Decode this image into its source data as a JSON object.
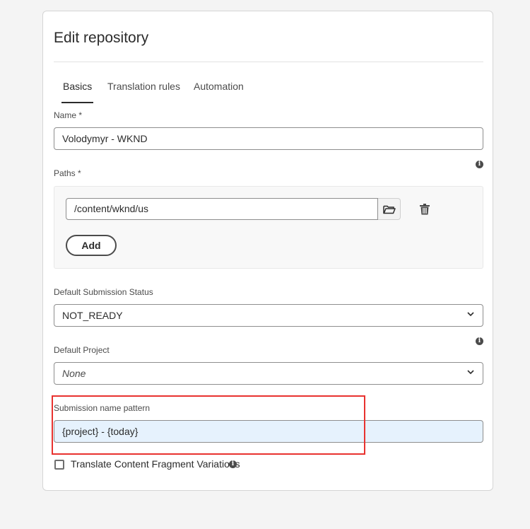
{
  "dialog": {
    "title": "Edit repository"
  },
  "tabs": [
    {
      "label": "Basics",
      "active": true
    },
    {
      "label": "Translation rules",
      "active": false
    },
    {
      "label": "Automation",
      "active": false
    }
  ],
  "name_field": {
    "label": "Name *",
    "value": "Volodymyr - WKND"
  },
  "paths": {
    "label": "Paths *",
    "items": [
      {
        "value": "/content/wknd/us"
      }
    ],
    "add_label": "Add"
  },
  "default_submission_status": {
    "label": "Default Submission Status",
    "value": "NOT_READY"
  },
  "default_project": {
    "label": "Default Project",
    "value": "None"
  },
  "submission_name_pattern": {
    "label": "Submission name pattern",
    "value": "{project} - {today}"
  },
  "translate_cf_variations": {
    "label": "Translate Content Fragment Variations",
    "checked": false
  },
  "icons": {
    "info": "info-icon",
    "folder": "folder-icon",
    "trash": "trash-icon",
    "chevron": "chevron-down-icon"
  },
  "colors": {
    "highlight": "#e8322f",
    "focus_field_bg": "#e6f2fd",
    "focus_field_border": "#8e8e8e"
  }
}
